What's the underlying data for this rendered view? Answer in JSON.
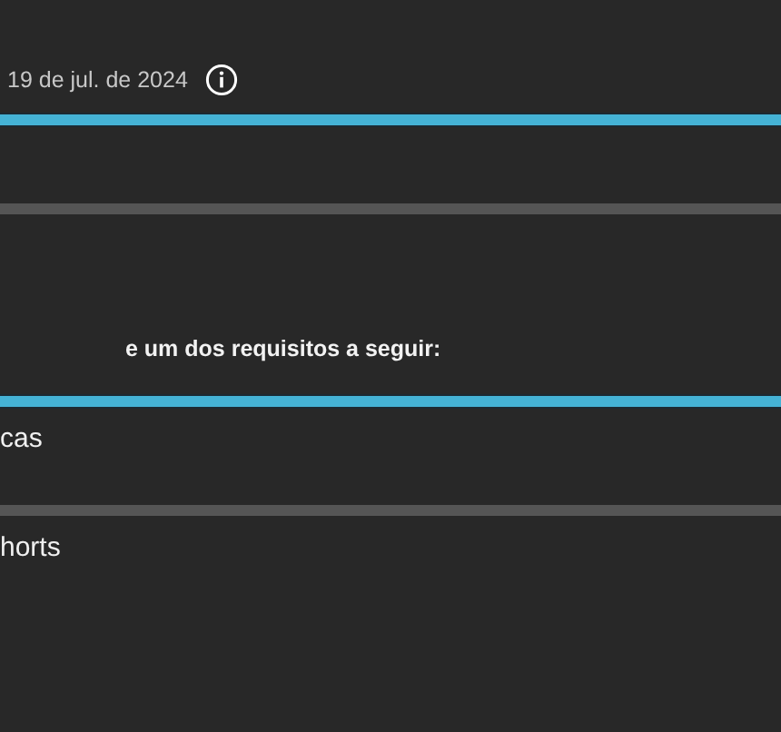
{
  "date": "19 de jul. de 2024",
  "top_bars": [
    {
      "level": 1
    },
    {
      "level": 0
    }
  ],
  "requirement_text": "e um dos requisitos a seguir:",
  "requirements": [
    {
      "label": "cas",
      "level": 1
    },
    {
      "label": "horts",
      "level": 0
    }
  ]
}
